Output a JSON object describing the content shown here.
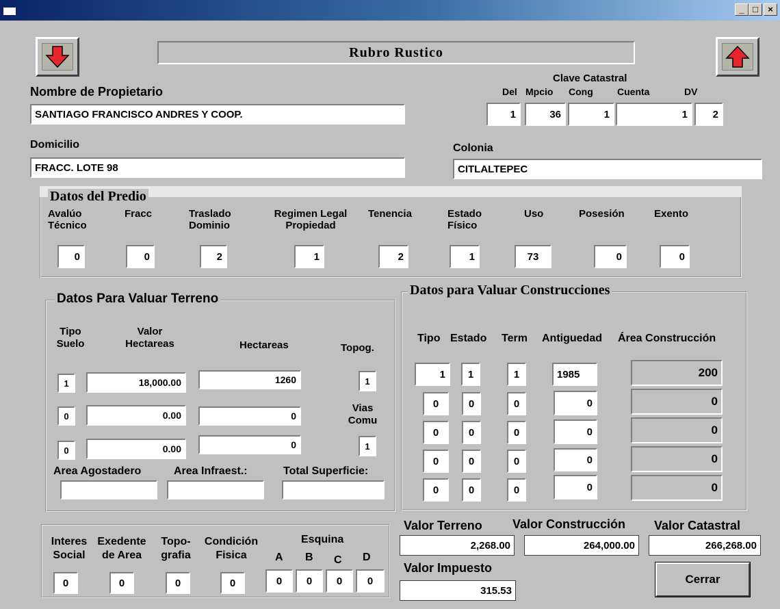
{
  "window": {
    "minimize": "_",
    "maximize": "□",
    "close": "×"
  },
  "header": {
    "title": "Rubro Rustico",
    "clave_catastral_label": "Clave Catastral"
  },
  "owner": {
    "label": "Nombre de Propietario",
    "value": "SANTIAGO FRANCISCO ANDRES Y COOP."
  },
  "clave": {
    "labels": {
      "del": "Del",
      "mpcio": "Mpcio",
      "cong": "Cong",
      "cuenta": "Cuenta",
      "dv": "DV"
    },
    "values": {
      "del": "1",
      "mpcio": "36",
      "cong": "1",
      "cuenta": "1",
      "dv": "2"
    }
  },
  "address": {
    "domicilio_label": "Domicilio",
    "domicilio": "FRACC. LOTE 98",
    "colonia_label": "Colonia",
    "colonia": "CITLALTEPEC"
  },
  "predio": {
    "title": "Datos del Predio",
    "fields": [
      {
        "label1": "Avalúo",
        "label2": "Técnico",
        "value": "0"
      },
      {
        "label1": "Fracc",
        "label2": "",
        "value": "0"
      },
      {
        "label1": "Traslado",
        "label2": "Dominio",
        "value": "2"
      },
      {
        "label1": "Regimen Legal",
        "label2": "Propiedad",
        "value": "1"
      },
      {
        "label1": "Tenencia",
        "label2": "",
        "value": "2"
      },
      {
        "label1": "Estado",
        "label2": "Físico",
        "value": "1"
      },
      {
        "label1": "Uso",
        "label2": "",
        "value": "73"
      },
      {
        "label1": "Posesión",
        "label2": "",
        "value": "0"
      },
      {
        "label1": "Exento",
        "label2": "",
        "value": "0"
      }
    ]
  },
  "terreno": {
    "title": "Datos Para Valuar Terreno",
    "col_tipo1": "Tipo",
    "col_tipo2": "Suelo",
    "col_valor1": "Valor",
    "col_valor2": "Hectareas",
    "col_hect": "Hectareas",
    "col_topog": "Topog.",
    "rows": [
      {
        "tipo": "1",
        "valor": "18,000.00",
        "hect": "1260"
      },
      {
        "tipo": "0",
        "valor": "0.00",
        "hect": "0"
      },
      {
        "tipo": "0",
        "valor": "0.00",
        "hect": "0"
      }
    ],
    "topog_value": "1",
    "vias1": "Vias",
    "vias2": "Comu",
    "vias_value": "1",
    "area_agostadero_label": "Area Agostadero",
    "area_agostadero": "",
    "area_infra_label": "Area Infraest.:",
    "area_infra": "",
    "total_sup_label": "Total Superficie:",
    "total_sup": ""
  },
  "construcciones": {
    "title": "Datos para Valuar Construcciones",
    "headers": {
      "tipo": "Tipo",
      "estado": "Estado",
      "term": "Term",
      "antig": "Antiguedad",
      "area": "Área Construcción"
    },
    "rows": [
      {
        "tipo": "1",
        "estado": "1",
        "term": "1",
        "antig": "1985",
        "area": "200"
      },
      {
        "tipo": "0",
        "estado": "0",
        "term": "0",
        "antig": "0",
        "area": "0"
      },
      {
        "tipo": "0",
        "estado": "0",
        "term": "0",
        "antig": "0",
        "area": "0"
      },
      {
        "tipo": "0",
        "estado": "0",
        "term": "0",
        "antig": "0",
        "area": "0"
      },
      {
        "tipo": "0",
        "estado": "0",
        "term": "0",
        "antig": "0",
        "area": "0"
      }
    ]
  },
  "extras": {
    "interes1": "Interes",
    "interes2": "Social",
    "interes_value": "0",
    "exedente1": "Exedente",
    "exedente2": "de Area",
    "exedente_value": "0",
    "topo1": "Topo-",
    "topo2": "grafia",
    "topo_value": "0",
    "cond1": "Condición",
    "cond2": "Fisica",
    "cond_value": "0",
    "esquina": "Esquina",
    "esq_labels": [
      "A",
      "B",
      "C",
      "D"
    ],
    "esq_values": [
      "0",
      "0",
      "0",
      "0"
    ]
  },
  "totals": {
    "valor_terreno_label": "Valor Terreno",
    "valor_terreno": "2,268.00",
    "valor_construccion_label": "Valor Construcción",
    "valor_construccion": "264,000.00",
    "valor_catastral_label": "Valor Catastral",
    "valor_catastral": "266,268.00",
    "valor_impuesto_label": "Valor Impuesto",
    "valor_impuesto": "315.53"
  },
  "buttons": {
    "cerrar": "Cerrar"
  }
}
